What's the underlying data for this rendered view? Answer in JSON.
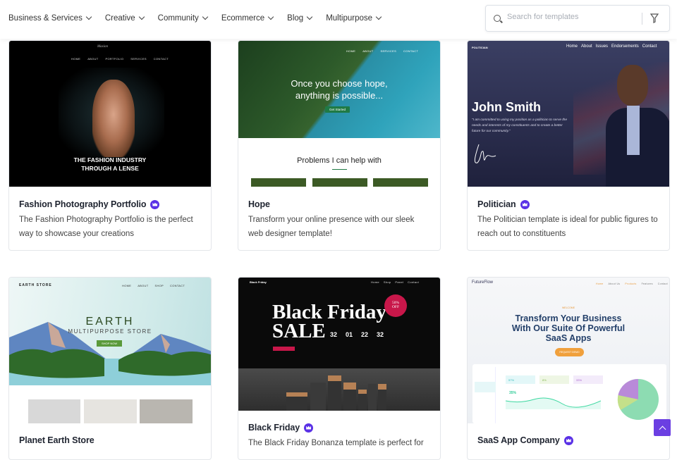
{
  "nav": {
    "items": [
      {
        "label": "Business & Services"
      },
      {
        "label": "Creative"
      },
      {
        "label": "Community"
      },
      {
        "label": "Ecommerce"
      },
      {
        "label": "Blog"
      },
      {
        "label": "Multipurpose"
      }
    ]
  },
  "search": {
    "placeholder": "Search for templates",
    "value": ""
  },
  "cards": [
    {
      "title": "Fashion Photography Portfolio",
      "premium": true,
      "desc": "The Fashion Photography Portfolio is the perfect way to showcase your creations",
      "thumb": {
        "nav": [
          "HOME",
          "ABOUT",
          "PORTFOLIO",
          "SERVICES",
          "CONTACT"
        ],
        "headline1": "THE FASHION INDUSTRY",
        "headline2": "THROUGH A LENSE"
      }
    },
    {
      "title": "Hope",
      "premium": false,
      "desc": "Transform your online presence with our sleek web designer template!",
      "thumb": {
        "nav": [
          "HOME",
          "ABOUT",
          "SERVICES",
          "CONTACT"
        ],
        "headline1": "Once you choose hope,",
        "headline2": "anything is possible...",
        "cta": "Get Started",
        "section": "Problems I can help with"
      }
    },
    {
      "title": "Politician",
      "premium": true,
      "desc": "The Politician template is ideal for public figures to reach out to constituents",
      "thumb": {
        "logo": "POLITICIAN",
        "nav": [
          "Home",
          "About",
          "Issues",
          "Endorsements",
          "Contact"
        ],
        "headline1": "John Smith",
        "quote": "\"I am committed to using my position as a politician to serve the needs and interests of my constituents and to create a better future for our community.\""
      }
    },
    {
      "title": "Planet Earth Store",
      "premium": false,
      "desc": "",
      "thumb": {
        "logo": "EARTH STORE",
        "nav": [
          "HOME",
          "ABOUT",
          "SHOP",
          "CONTACT"
        ],
        "headline1": "EARTH",
        "headline2": "MULTIPURPOSE STORE",
        "cta": "SHOP NOW"
      }
    },
    {
      "title": "Black Friday",
      "premium": true,
      "desc": "The Black Friday Bonanza template is perfect for",
      "thumb": {
        "logo": "Black Friday",
        "nav": [
          "Home",
          "Shop",
          "Panel",
          "Contact"
        ],
        "headline1": "Black Friday",
        "headline2": "SALE",
        "badge": "50% OFF",
        "countdown": [
          "32",
          "01",
          "22",
          "32"
        ]
      }
    },
    {
      "title": "SaaS App Company",
      "premium": true,
      "desc": "",
      "thumb": {
        "logo": "FutureFlow",
        "nav": [
          "Home",
          "About Us",
          "Products",
          "Features",
          "Contact"
        ],
        "kicker": "WELCOME",
        "headline1": "Transform Your Business",
        "headline2": "With Our Suite Of Powerful",
        "headline3": "SaaS Apps",
        "cta": "REQUEST DEMO",
        "stats": [
          "57%",
          "8%",
          "33%"
        ],
        "big": "35%"
      }
    }
  ],
  "colors": {
    "premium": "#5a31e6",
    "accent": "#6b3fe2"
  }
}
